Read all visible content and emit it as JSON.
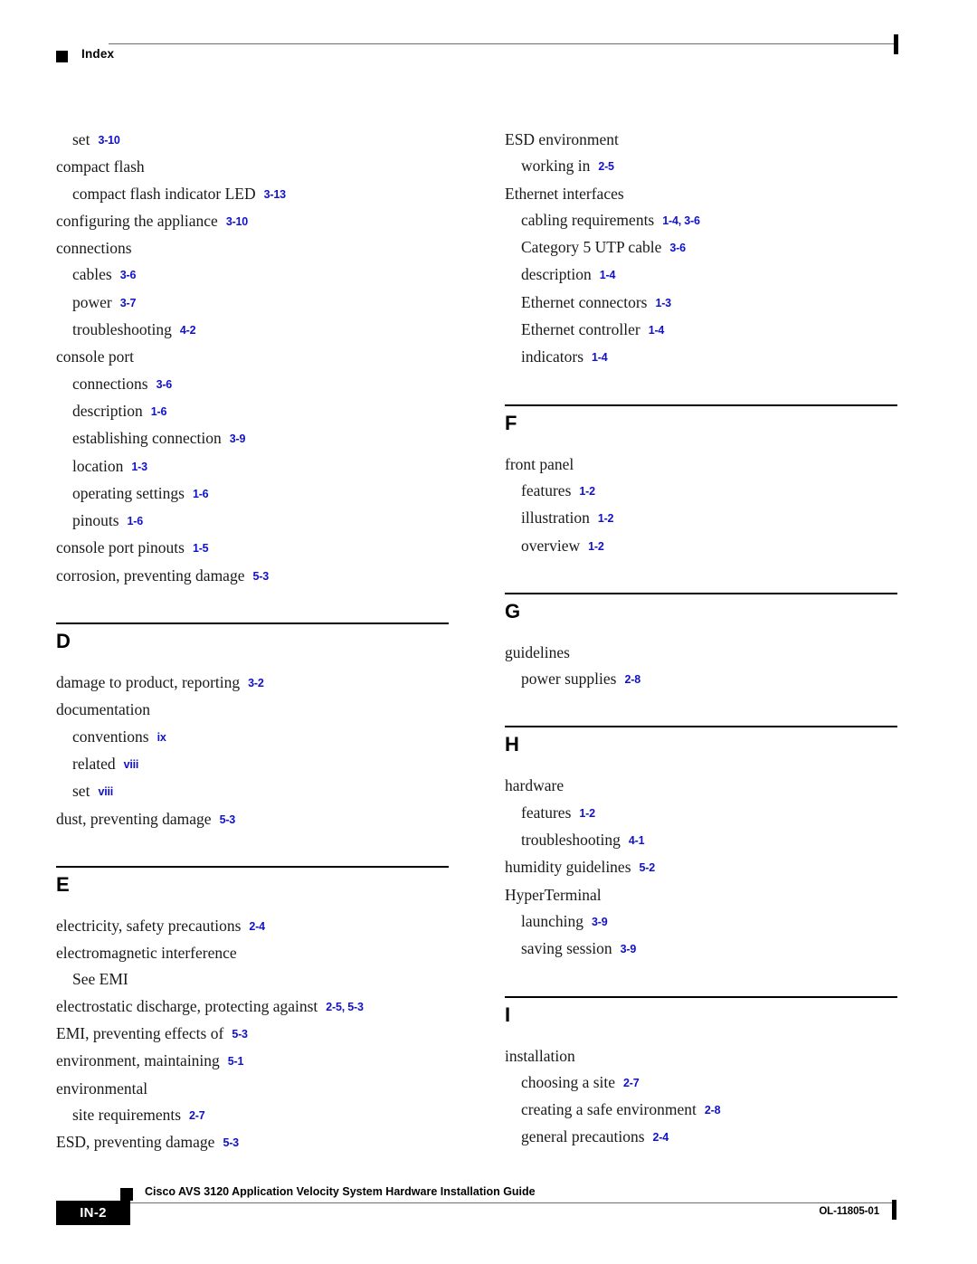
{
  "header": {
    "title": "Index",
    "square_icon": "black-square-marker"
  },
  "colors": {
    "page_reference_blue": "#1111cc",
    "text_black": "#000000",
    "rule_gray": "#6d6d6d"
  },
  "columns": {
    "left": [
      {
        "kind": "entry",
        "level": 1,
        "term": "set",
        "ref": "3-10"
      },
      {
        "kind": "entry",
        "level": 0,
        "term": "compact flash",
        "ref": ""
      },
      {
        "kind": "entry",
        "level": 1,
        "term": "compact flash indicator LED",
        "ref": "3-13"
      },
      {
        "kind": "entry",
        "level": 0,
        "term": "configuring the appliance",
        "ref": "3-10"
      },
      {
        "kind": "entry",
        "level": 0,
        "term": "connections",
        "ref": ""
      },
      {
        "kind": "entry",
        "level": 1,
        "term": "cables",
        "ref": "3-6"
      },
      {
        "kind": "entry",
        "level": 1,
        "term": "power",
        "ref": "3-7"
      },
      {
        "kind": "entry",
        "level": 1,
        "term": "troubleshooting",
        "ref": "4-2"
      },
      {
        "kind": "entry",
        "level": 0,
        "term": "console port",
        "ref": ""
      },
      {
        "kind": "entry",
        "level": 1,
        "term": "connections",
        "ref": "3-6"
      },
      {
        "kind": "entry",
        "level": 1,
        "term": "description",
        "ref": "1-6"
      },
      {
        "kind": "entry",
        "level": 1,
        "term": "establishing connection",
        "ref": "3-9"
      },
      {
        "kind": "entry",
        "level": 1,
        "term": "location",
        "ref": "1-3"
      },
      {
        "kind": "entry",
        "level": 1,
        "term": "operating settings",
        "ref": "1-6"
      },
      {
        "kind": "entry",
        "level": 1,
        "term": "pinouts",
        "ref": "1-6"
      },
      {
        "kind": "entry",
        "level": 0,
        "term": "console port pinouts",
        "ref": "1-5"
      },
      {
        "kind": "entry",
        "level": 0,
        "term": "corrosion, preventing damage",
        "ref": "5-3"
      },
      {
        "kind": "section",
        "letter": "D"
      },
      {
        "kind": "entry",
        "level": 0,
        "term": "damage to product, reporting",
        "ref": "3-2"
      },
      {
        "kind": "entry",
        "level": 0,
        "term": "documentation",
        "ref": ""
      },
      {
        "kind": "entry",
        "level": 1,
        "term": "conventions",
        "ref": "ix"
      },
      {
        "kind": "entry",
        "level": 1,
        "term": "related",
        "ref": "viii"
      },
      {
        "kind": "entry",
        "level": 1,
        "term": "set",
        "ref": "viii"
      },
      {
        "kind": "entry",
        "level": 0,
        "term": "dust, preventing damage",
        "ref": "5-3"
      },
      {
        "kind": "section",
        "letter": "E"
      },
      {
        "kind": "entry",
        "level": 0,
        "term": "electricity, safety precautions",
        "ref": "2-4"
      },
      {
        "kind": "entry",
        "level": 0,
        "term": "electromagnetic interference",
        "ref": ""
      },
      {
        "kind": "entry",
        "level": 1,
        "term": "See EMI",
        "ref": ""
      },
      {
        "kind": "entry",
        "level": 0,
        "term": "electrostatic discharge, protecting against",
        "ref": "2-5, 5-3"
      },
      {
        "kind": "entry",
        "level": 0,
        "term": "EMI, preventing effects of",
        "ref": "5-3"
      },
      {
        "kind": "entry",
        "level": 0,
        "term": "environment, maintaining",
        "ref": "5-1"
      },
      {
        "kind": "entry",
        "level": 0,
        "term": "environmental",
        "ref": ""
      },
      {
        "kind": "entry",
        "level": 1,
        "term": "site requirements",
        "ref": "2-7"
      },
      {
        "kind": "entry",
        "level": 0,
        "term": "ESD, preventing damage",
        "ref": "5-3"
      }
    ],
    "right": [
      {
        "kind": "entry",
        "level": 0,
        "term": "ESD environment",
        "ref": ""
      },
      {
        "kind": "entry",
        "level": 1,
        "term": "working in",
        "ref": "2-5"
      },
      {
        "kind": "entry",
        "level": 0,
        "term": "Ethernet interfaces",
        "ref": ""
      },
      {
        "kind": "entry",
        "level": 1,
        "term": "cabling requirements",
        "ref": "1-4, 3-6"
      },
      {
        "kind": "entry",
        "level": 1,
        "term": "Category 5 UTP cable",
        "ref": "3-6"
      },
      {
        "kind": "entry",
        "level": 1,
        "term": "description",
        "ref": "1-4"
      },
      {
        "kind": "entry",
        "level": 1,
        "term": "Ethernet connectors",
        "ref": "1-3"
      },
      {
        "kind": "entry",
        "level": 1,
        "term": "Ethernet controller",
        "ref": "1-4"
      },
      {
        "kind": "entry",
        "level": 1,
        "term": "indicators",
        "ref": "1-4"
      },
      {
        "kind": "section",
        "letter": "F"
      },
      {
        "kind": "entry",
        "level": 0,
        "term": "front panel",
        "ref": ""
      },
      {
        "kind": "entry",
        "level": 1,
        "term": "features",
        "ref": "1-2"
      },
      {
        "kind": "entry",
        "level": 1,
        "term": "illustration",
        "ref": "1-2"
      },
      {
        "kind": "entry",
        "level": 1,
        "term": "overview",
        "ref": "1-2"
      },
      {
        "kind": "section",
        "letter": "G"
      },
      {
        "kind": "entry",
        "level": 0,
        "term": "guidelines",
        "ref": ""
      },
      {
        "kind": "entry",
        "level": 1,
        "term": "power supplies",
        "ref": "2-8"
      },
      {
        "kind": "section",
        "letter": "H"
      },
      {
        "kind": "entry",
        "level": 0,
        "term": "hardware",
        "ref": ""
      },
      {
        "kind": "entry",
        "level": 1,
        "term": "features",
        "ref": "1-2"
      },
      {
        "kind": "entry",
        "level": 1,
        "term": "troubleshooting",
        "ref": "4-1"
      },
      {
        "kind": "entry",
        "level": 0,
        "term": "humidity guidelines",
        "ref": "5-2"
      },
      {
        "kind": "entry",
        "level": 0,
        "term": "HyperTerminal",
        "ref": ""
      },
      {
        "kind": "entry",
        "level": 1,
        "term": "launching",
        "ref": "3-9"
      },
      {
        "kind": "entry",
        "level": 1,
        "term": "saving session",
        "ref": "3-9"
      },
      {
        "kind": "section",
        "letter": "I"
      },
      {
        "kind": "entry",
        "level": 0,
        "term": "installation",
        "ref": ""
      },
      {
        "kind": "entry",
        "level": 1,
        "term": "choosing a site",
        "ref": "2-7"
      },
      {
        "kind": "entry",
        "level": 1,
        "term": "creating a safe environment",
        "ref": "2-8"
      },
      {
        "kind": "entry",
        "level": 1,
        "term": "general precautions",
        "ref": "2-4"
      }
    ]
  },
  "footer": {
    "page_number": "IN-2",
    "title": "Cisco AVS 3120 Application Velocity System Hardware Installation Guide",
    "doc_id": "OL-11805-01",
    "square_icon": "black-square-marker"
  }
}
